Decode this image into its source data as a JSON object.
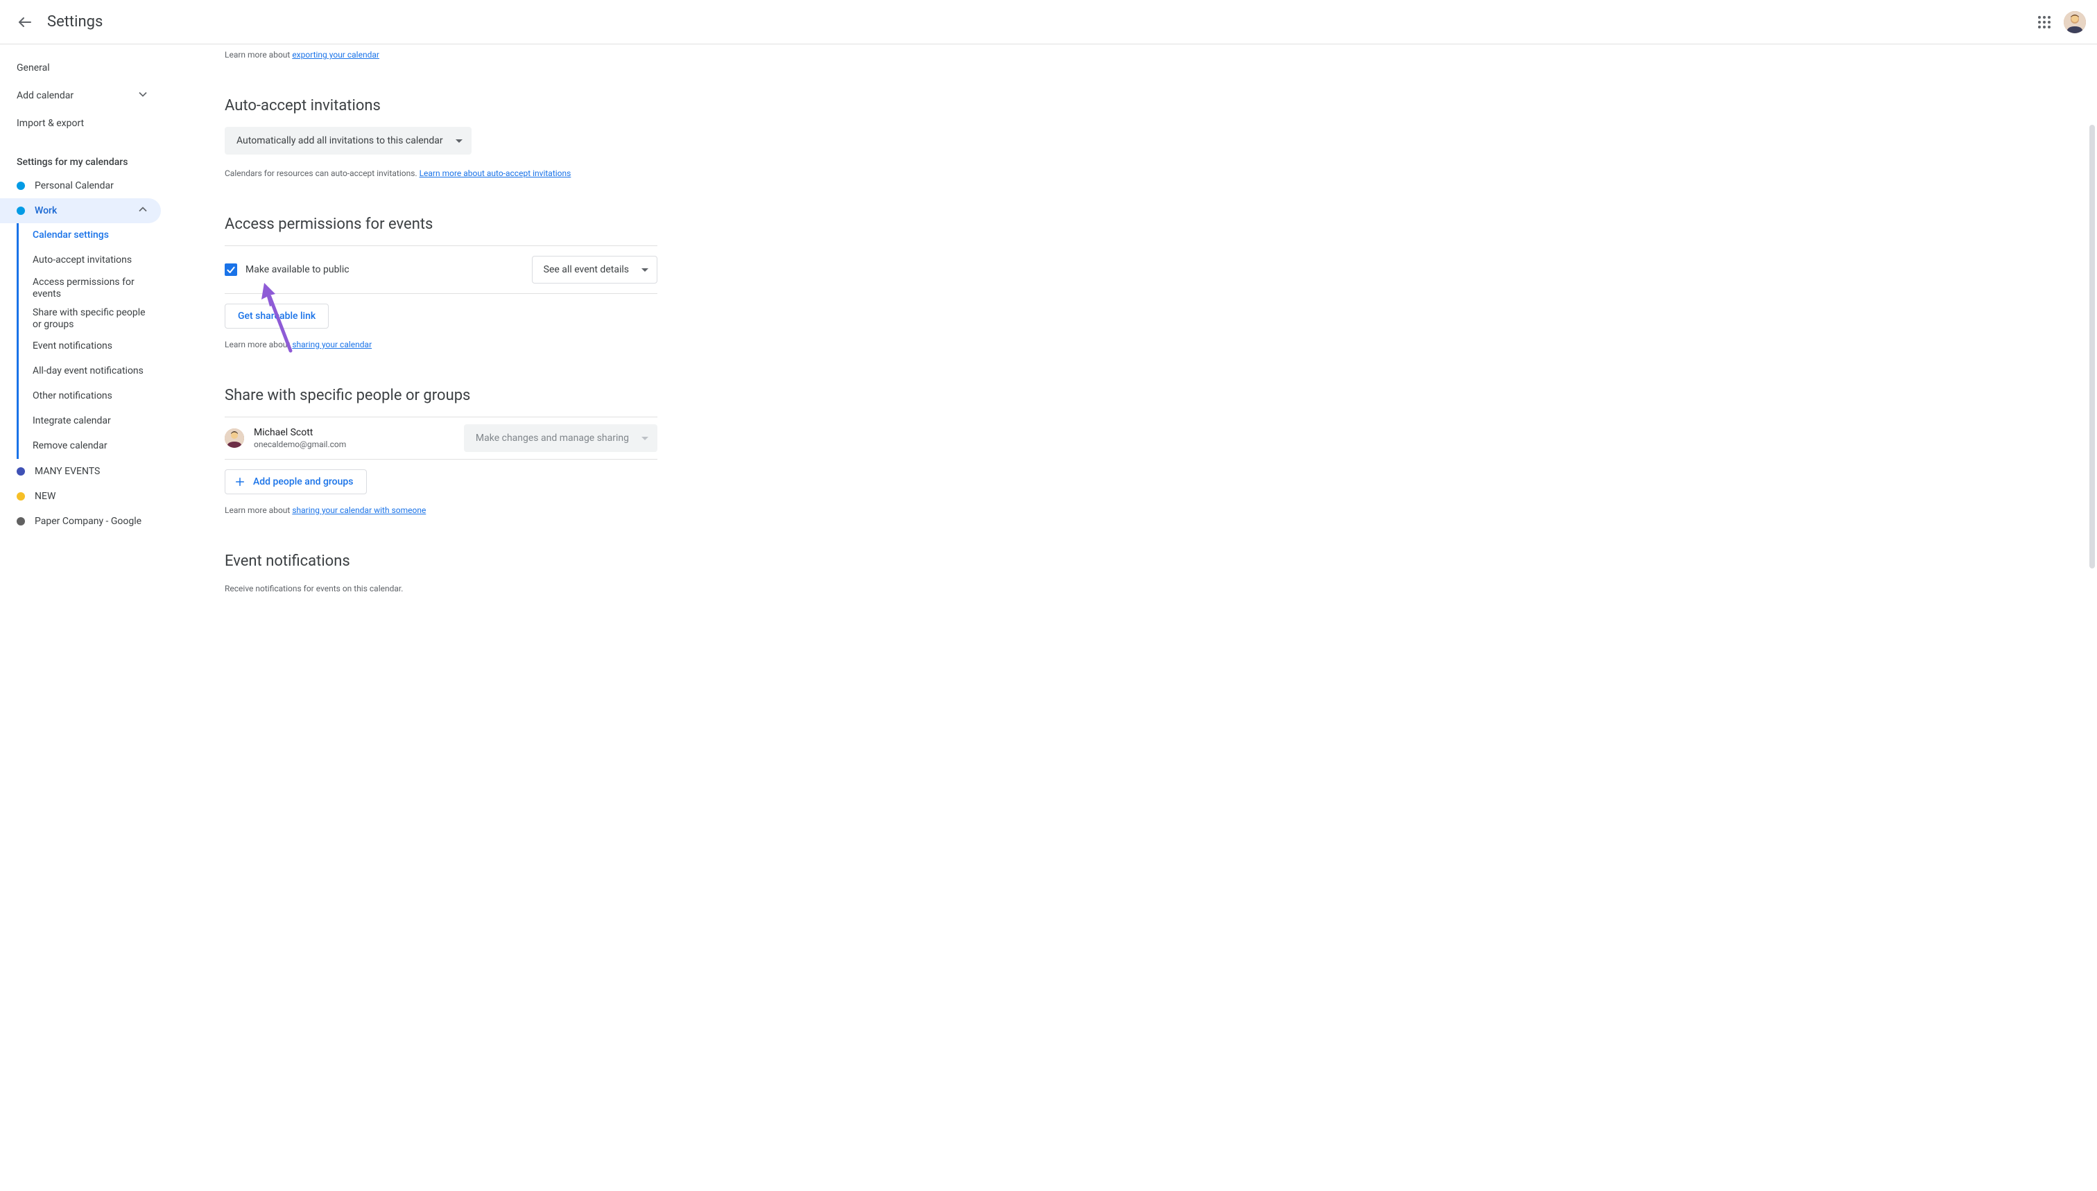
{
  "header": {
    "title": "Settings"
  },
  "sidebar": {
    "top_items": [
      {
        "label": "General"
      },
      {
        "label": "Add calendar",
        "expandable": true
      },
      {
        "label": "Import & export"
      }
    ],
    "section_heading": "Settings for my calendars",
    "calendars": [
      {
        "label": "Personal Calendar",
        "color": "#039be5"
      },
      {
        "label": "Work",
        "color": "#039be5",
        "expanded": true,
        "selected": true
      },
      {
        "label": "MANY EVENTS",
        "color": "#3f51b5"
      },
      {
        "label": "NEW",
        "color": "#f6bf26"
      },
      {
        "label": "Paper Company - Google",
        "color": "#616161"
      }
    ],
    "work_subitems": [
      {
        "label": "Calendar settings",
        "active": true
      },
      {
        "label": "Auto-accept invitations"
      },
      {
        "label": "Access permissions for events",
        "two_line": true
      },
      {
        "label": "Share with specific people or groups",
        "two_line": true
      },
      {
        "label": "Event notifications"
      },
      {
        "label": "All-day event notifications"
      },
      {
        "label": "Other notifications"
      },
      {
        "label": "Integrate calendar"
      },
      {
        "label": "Remove calendar"
      }
    ]
  },
  "main": {
    "export_prefix": "Learn more about ",
    "export_link": "exporting your calendar",
    "auto_accept": {
      "title": "Auto-accept invitations",
      "select_value": "Automatically add all invitations to this calendar",
      "helper_pre": "Calendars for resources can auto-accept invitations. ",
      "helper_link": "Learn more about auto-accept invitations"
    },
    "access": {
      "title": "Access permissions for events",
      "checkbox_label": "Make available to public",
      "checkbox_checked": true,
      "visibility_value": "See all event details",
      "shareable_btn": "Get shareable link",
      "helper_pre": "Learn more about ",
      "helper_link": "sharing your calendar"
    },
    "share": {
      "title": "Share with specific people or groups",
      "person_name": "Michael Scott",
      "person_email": "onecaldemo@gmail.com",
      "permission_value": "Make changes and manage sharing",
      "add_btn": "Add people and groups",
      "helper_pre": "Learn more about ",
      "helper_link": "sharing your calendar with someone"
    },
    "notifications": {
      "title": "Event notifications",
      "helper": "Receive notifications for events on this calendar."
    }
  },
  "colors": {
    "primary": "#1a73e8",
    "text_secondary": "#5f6368"
  }
}
